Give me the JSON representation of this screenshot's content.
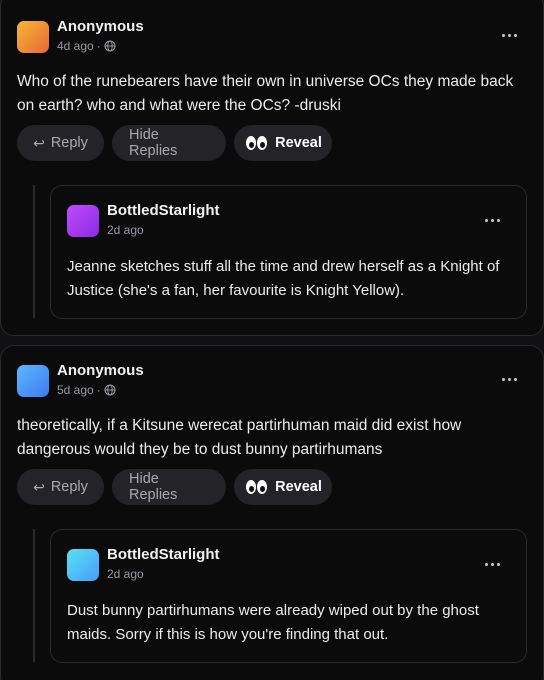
{
  "posts": [
    {
      "author": "Anonymous",
      "time": "4d ago",
      "avatar_colors": [
        "#f7b733",
        "#e8683a"
      ],
      "text": "Who of the runebearers have their own in universe OCs they made back on earth? who and what were the OCs? -druski",
      "reply": {
        "author": "BottledStarlight",
        "time": "2d ago",
        "avatar_colors": [
          "#c04bff",
          "#8a2be2"
        ],
        "text": "Jeanne sketches stuff all the time and drew herself as a Knight of Justice (she's a fan, her favourite is Knight Yellow)."
      }
    },
    {
      "author": "Anonymous",
      "time": "5d ago",
      "avatar_colors": [
        "#5ab8ff",
        "#3d7bf0"
      ],
      "text": "theoretically, if a Kitsune werecat partirhuman maid did exist how dangerous would they be to dust bunny partirhumans",
      "reply": {
        "author": "BottledStarlight",
        "time": "2d ago",
        "avatar_colors": [
          "#57e3f0",
          "#4a9bff"
        ],
        "text": "Dust bunny partirhumans were already wiped out by the ghost maids. Sorry if this is how you're finding that out."
      }
    }
  ],
  "actions": {
    "reply_label": "Reply",
    "hide_label": "Hide Replies",
    "reveal_label": "Reveal"
  },
  "meta_separator": "·"
}
